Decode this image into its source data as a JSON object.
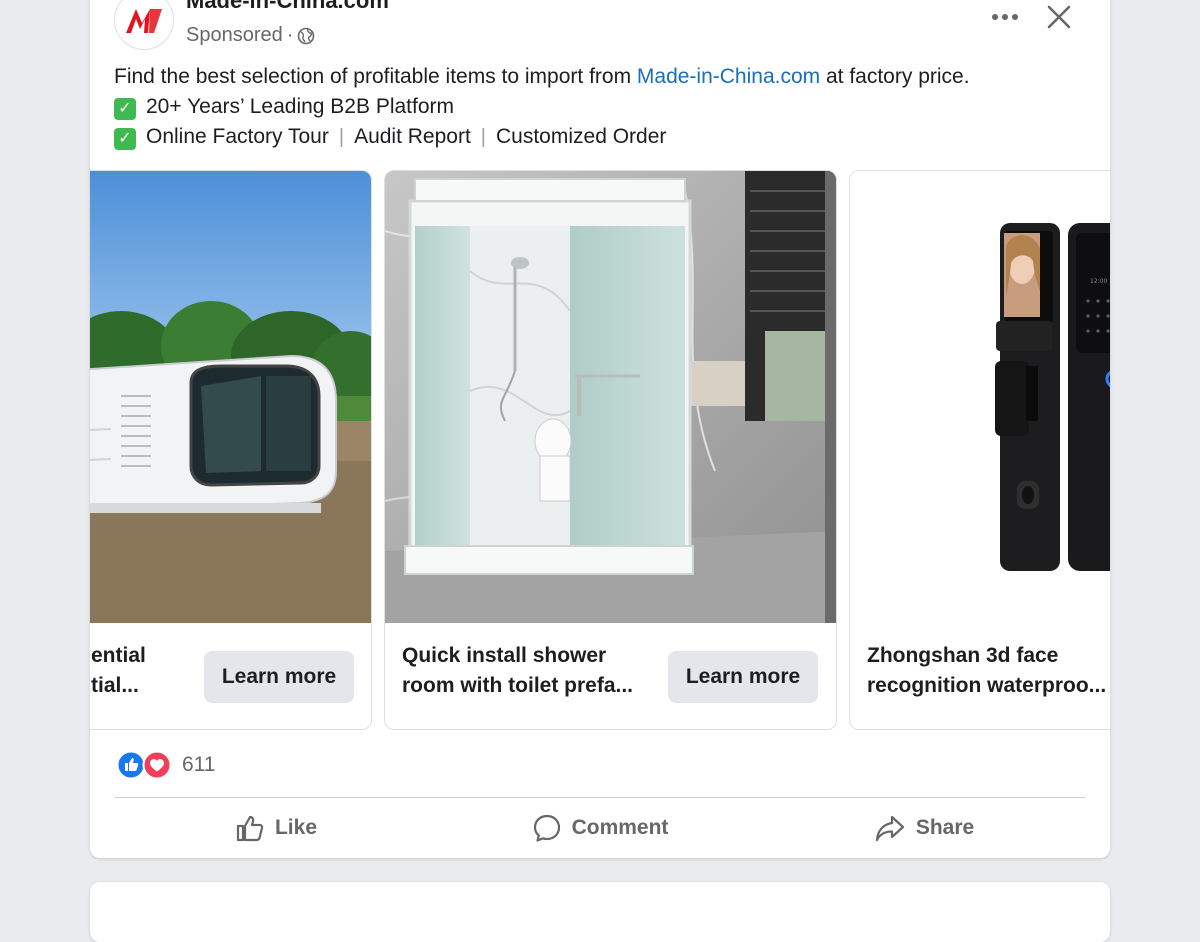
{
  "post": {
    "page_name": "Made-in-China.com",
    "sponsored_label": "Sponsored",
    "meta_separator": "·",
    "text_intro": "Find the best selection of profitable items to import from ",
    "text_link": "Made-in-China.com",
    "text_outro": " at factory price.",
    "line2": "20+ Years’ Leading B2B Platform",
    "line3_items": [
      "Online Factory Tour",
      "Audit Report",
      "Customized Order"
    ],
    "line3_sep": "|"
  },
  "carousel": {
    "cards": [
      {
        "title_line1": "ential",
        "title_line2": "tial...",
        "button": "Learn more"
      },
      {
        "title_line1": "Quick install shower",
        "title_line2": "room with toilet prefa...",
        "button": "Learn more"
      },
      {
        "title_line1": "Zhongshan 3d face",
        "title_line2": "recognition waterproo..."
      }
    ]
  },
  "reactions": {
    "count": "611"
  },
  "actions": {
    "like": "Like",
    "comment": "Comment",
    "share": "Share"
  },
  "colors": {
    "link": "#1a6ebd",
    "like_blue": "#1877f2",
    "love_red": "#f33e58",
    "check_green": "#3fb950",
    "logo_red": "#e3141b"
  }
}
